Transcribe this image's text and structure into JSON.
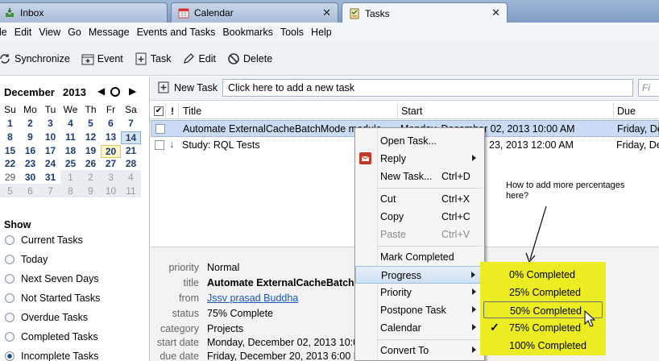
{
  "tabs": [
    {
      "label": "Inbox",
      "icon": "inbox-icon"
    },
    {
      "label": "Calendar",
      "icon": "calendar-icon"
    },
    {
      "label": "Tasks",
      "icon": "tasks-icon"
    }
  ],
  "menubar": [
    "le",
    "Edit",
    "View",
    "Go",
    "Message",
    "Events and Tasks",
    "Bookmarks",
    "Tools",
    "Help"
  ],
  "toolbar": {
    "synchronize": "Synchronize",
    "event": "Event",
    "task": "Task",
    "edit": "Edit",
    "delete": "Delete"
  },
  "calendar": {
    "month": "December",
    "year": "2013",
    "days_of_week": [
      "Su",
      "Mo",
      "Tu",
      "We",
      "Th",
      "Fr",
      "Sa"
    ],
    "weeks": [
      [
        "1",
        "2",
        "3",
        "4",
        "5",
        "6",
        "7"
      ],
      [
        "8",
        "9",
        "10",
        "11",
        "12",
        "13",
        "14"
      ],
      [
        "15",
        "16",
        "17",
        "18",
        "19",
        "20",
        "21"
      ],
      [
        "22",
        "23",
        "24",
        "25",
        "26",
        "27",
        "28"
      ],
      [
        "29",
        "30",
        "31",
        "1",
        "2",
        "3",
        "4"
      ],
      [
        "5",
        "6",
        "7",
        "8",
        "9",
        "10",
        "11"
      ]
    ],
    "today": "20",
    "selected": "14"
  },
  "show": {
    "heading": "Show",
    "filters": [
      "Current Tasks",
      "Today",
      "Next Seven Days",
      "Not Started Tasks",
      "Overdue Tasks",
      "Completed Tasks",
      "Incomplete Tasks"
    ],
    "selected": "Incomplete Tasks"
  },
  "newtask": {
    "button": "New Task",
    "placeholder": "Click here to add a new task",
    "filter_placeholder": "Fi"
  },
  "columns": {
    "title": "Title",
    "start": "Start",
    "due": "Due"
  },
  "tasks": [
    {
      "title": "Automate ExternalCacheBatchMode module",
      "start": "Monday, December 02, 2013 10:00 AM",
      "due": "Friday, De"
    },
    {
      "title": "Study: RQL Tests",
      "start": "23, 2013 12:00 AM",
      "due": "Friday, De"
    }
  ],
  "details": {
    "labels": {
      "priority": "priority",
      "title": "title",
      "from": "from",
      "status": "status",
      "category": "category",
      "start": "start date",
      "due": "due date"
    },
    "priority": "Normal",
    "title": "Automate ExternalCacheBatchMo",
    "from": "Jssv prasad Buddha",
    "status": "75% Complete",
    "category": "Projects",
    "start": "Monday, December 02, 2013 10:00",
    "due": "Friday, December 20, 2013 6:00 PM"
  },
  "context_menu": {
    "items": [
      {
        "label": "Open Task...",
        "shortcut": ""
      },
      {
        "label": "Reply",
        "shortcut": ""
      },
      {
        "label": "New Task...",
        "shortcut": "Ctrl+D"
      },
      {
        "label": "Cut",
        "shortcut": "Ctrl+X"
      },
      {
        "label": "Copy",
        "shortcut": "Ctrl+C"
      },
      {
        "label": "Paste",
        "shortcut": "Ctrl+V"
      },
      {
        "label": "Mark Completed",
        "shortcut": ""
      },
      {
        "label": "Progress",
        "shortcut": ""
      },
      {
        "label": "Priority",
        "shortcut": ""
      },
      {
        "label": "Postpone Task",
        "shortcut": ""
      },
      {
        "label": "Calendar",
        "shortcut": ""
      },
      {
        "label": "Convert To",
        "shortcut": ""
      }
    ]
  },
  "progress_submenu": {
    "items": [
      "0% Completed",
      "25% Completed",
      "50% Completed",
      "75% Completed",
      "100% Completed"
    ],
    "checked": "75% Completed",
    "hovered": "50% Completed"
  },
  "annotation": "How to add more percentages here?",
  "colors": {
    "highlight": "#ecec22",
    "selection": "#c9dcf3",
    "link": "#1a56b8"
  }
}
